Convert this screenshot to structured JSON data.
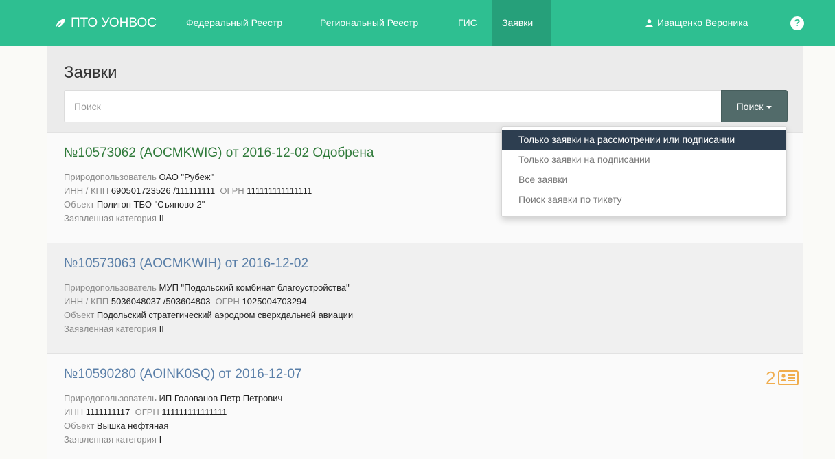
{
  "navbar": {
    "brand": "ПТО УОНВОС",
    "items": [
      {
        "label": "Федеральный Реестр",
        "active": false
      },
      {
        "label": "Региональный Реестр",
        "active": false
      },
      {
        "label": "ГИС",
        "active": false
      },
      {
        "label": "Заявки",
        "active": true
      }
    ],
    "user": "Иващенко Вероника",
    "help_symbol": "?",
    "brand_color": "#2ebf91"
  },
  "page": {
    "title": "Заявки"
  },
  "search": {
    "placeholder": "Поиск",
    "button_label": "Поиск"
  },
  "dropdown": {
    "items": [
      {
        "label": "Только заявки на рассмотрении или подписании",
        "active": true
      },
      {
        "label": "Только заявки на подписании",
        "active": false
      },
      {
        "label": "Все заявки",
        "active": false
      },
      {
        "label": "Поиск заявки по тикету",
        "active": false
      }
    ]
  },
  "labels": {
    "user": "Природопользователь",
    "inn_kpp": "ИНН / КПП",
    "inn": "ИНН",
    "ogrn": "ОГРН",
    "object": "Объект",
    "category": "Заявленная категория"
  },
  "applications": [
    {
      "title": "№10573062 (AOCMKWIG) от 2016-12-02 Одобрена",
      "user": "ОАО \"Рубеж\"",
      "inn_kpp": "690501723526 /111111111",
      "ogrn": "111111111111111",
      "object": "Полигон ТБО \"Съяново-2\"",
      "category": "II"
    },
    {
      "title": "№10573063 (AOCMKWIH) от 2016-12-02",
      "user": "МУП \"Подольский комбинат благоустройства\"",
      "inn_kpp": "5036048037 /503604803",
      "ogrn": "1025004703294",
      "object": "Подольский стратегический аэродром сверхдальней авиации",
      "category": "II"
    },
    {
      "title": "№10590280 (AOINK0SQ) от 2016-12-07",
      "user": "ИП Голованов Петр Петрович",
      "inn": "1111111117",
      "ogrn": "111111111111111",
      "object": "Вышка нефтяная",
      "category": "I",
      "badge_count": "2",
      "badge_icon": "id-card-icon"
    }
  ]
}
